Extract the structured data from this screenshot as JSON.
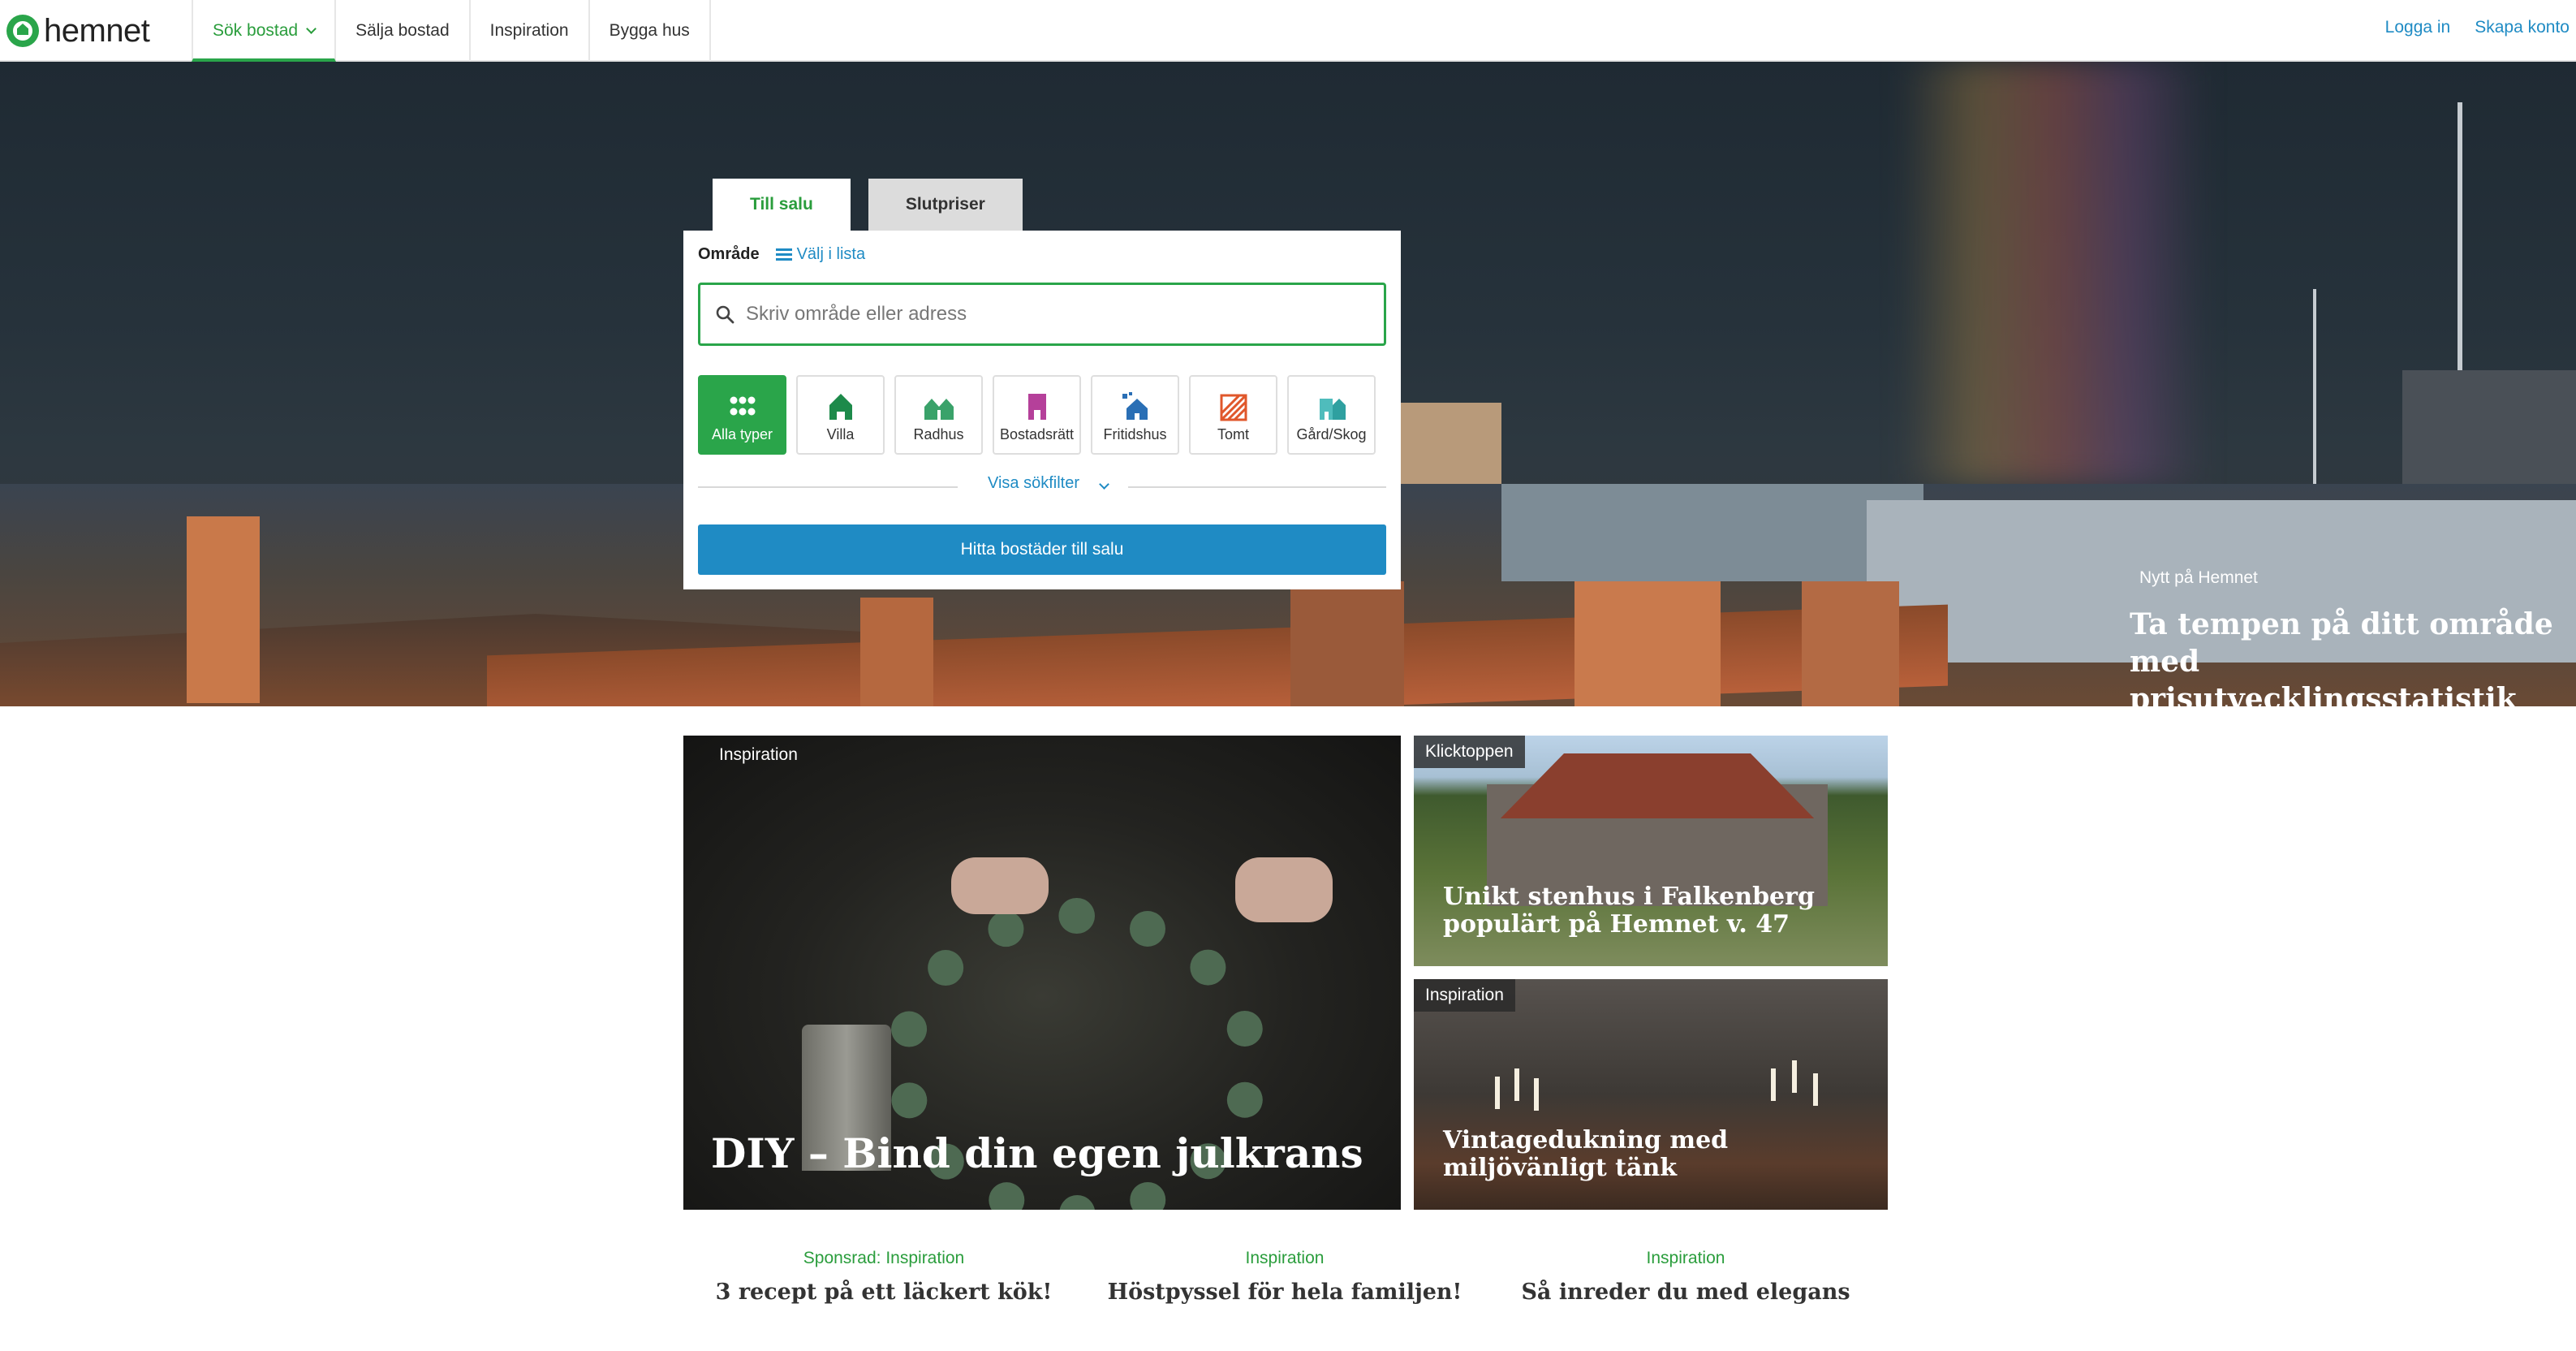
{
  "brand": {
    "name": "hemnet",
    "accent": "#2aa54a",
    "link_color": "#1f8bc4"
  },
  "nav": {
    "tabs": [
      {
        "label": "Sök bostad",
        "active": true
      },
      {
        "label": "Sälja bostad"
      },
      {
        "label": "Inspiration"
      },
      {
        "label": "Bygga hus"
      }
    ],
    "login": "Logga in",
    "signup": "Skapa konto"
  },
  "search": {
    "tabs": [
      "Till salu",
      "Slutpriser"
    ],
    "area_label": "Område",
    "list_link": "Välj i lista",
    "placeholder": "Skriv område eller adress",
    "types": [
      {
        "label": "Alla typer",
        "icon": "grid-dots-icon",
        "active": true
      },
      {
        "label": "Villa",
        "icon": "house-icon"
      },
      {
        "label": "Radhus",
        "icon": "townhouse-icon"
      },
      {
        "label": "Bostadsrätt",
        "icon": "apartment-icon"
      },
      {
        "label": "Fritidshus",
        "icon": "holiday-house-icon"
      },
      {
        "label": "Tomt",
        "icon": "plot-icon"
      },
      {
        "label": "Gård/Skog",
        "icon": "farm-icon"
      }
    ],
    "filter_link": "Visa sökfilter",
    "submit": "Hitta bostäder till salu"
  },
  "hero_promo": {
    "label": "Nytt på Hemnet",
    "title": "Ta tempen på ditt område med prisutvecklingsstatistik"
  },
  "cards": {
    "main": {
      "tag": "Inspiration",
      "title": "DIY – Bind din egen julkrans"
    },
    "side1": {
      "tag": "Klicktoppen",
      "title": "Unikt stenhus i Falkenberg populärt på Hemnet v. 47"
    },
    "side2": {
      "tag": "Inspiration",
      "title": "Vintagedukning med miljövänligt tänk"
    }
  },
  "bottom_links": [
    {
      "category": "Sponsrad: Inspiration",
      "title": "3 recept på ett läckert kök!"
    },
    {
      "category": "Inspiration",
      "title": "Höstpyssel för hela familjen!"
    },
    {
      "category": "Inspiration",
      "title": "Så inreder du med elegans"
    }
  ]
}
